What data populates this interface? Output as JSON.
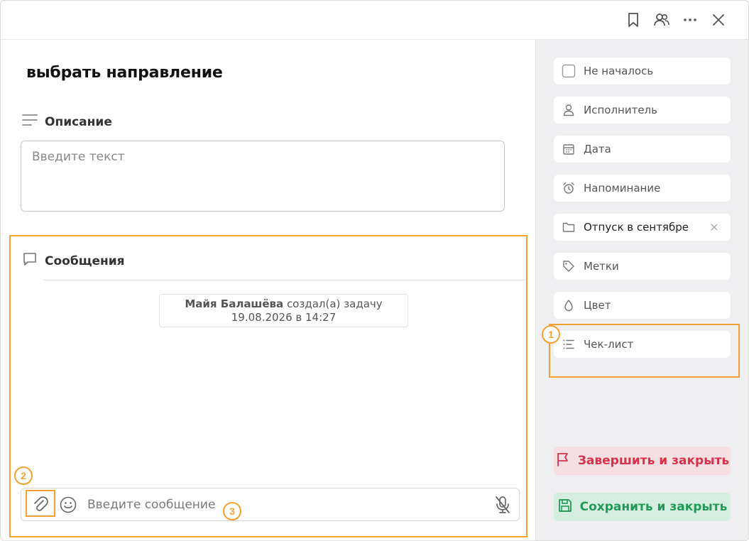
{
  "header": {
    "bookmark_icon": "bookmark-icon",
    "people_icon": "people-icon",
    "more_icon": "more-icon",
    "close_icon": "close-icon"
  },
  "task": {
    "title": "выбрать направление"
  },
  "description": {
    "heading": "Описание",
    "placeholder": "Введите текст"
  },
  "messages": {
    "heading": "Сообщения",
    "event_author": "Майя Балашёва",
    "event_action": "создал(а) задачу",
    "event_time": "19.08.2026 в 14:27",
    "composer_placeholder": "Введите сообщение"
  },
  "sidebar": {
    "status": "Не началось",
    "assignee": "Исполнитель",
    "date": "Дата",
    "reminder": "Напоминание",
    "project": "Отпуск в сентябре",
    "tags": "Метки",
    "color": "Цвет",
    "checklist": "Чек-лист"
  },
  "actions": {
    "finish": "Завершить и закрыть",
    "save": "Сохранить и закрыть"
  },
  "annotations": {
    "badge1": "1",
    "badge2": "2",
    "badge3": "3",
    "color": "#f5a031"
  },
  "colors": {
    "finish_text": "#d9314c",
    "finish_bg": "#f6dfe3",
    "save_text": "#209a55",
    "save_bg": "#d6eee1"
  }
}
